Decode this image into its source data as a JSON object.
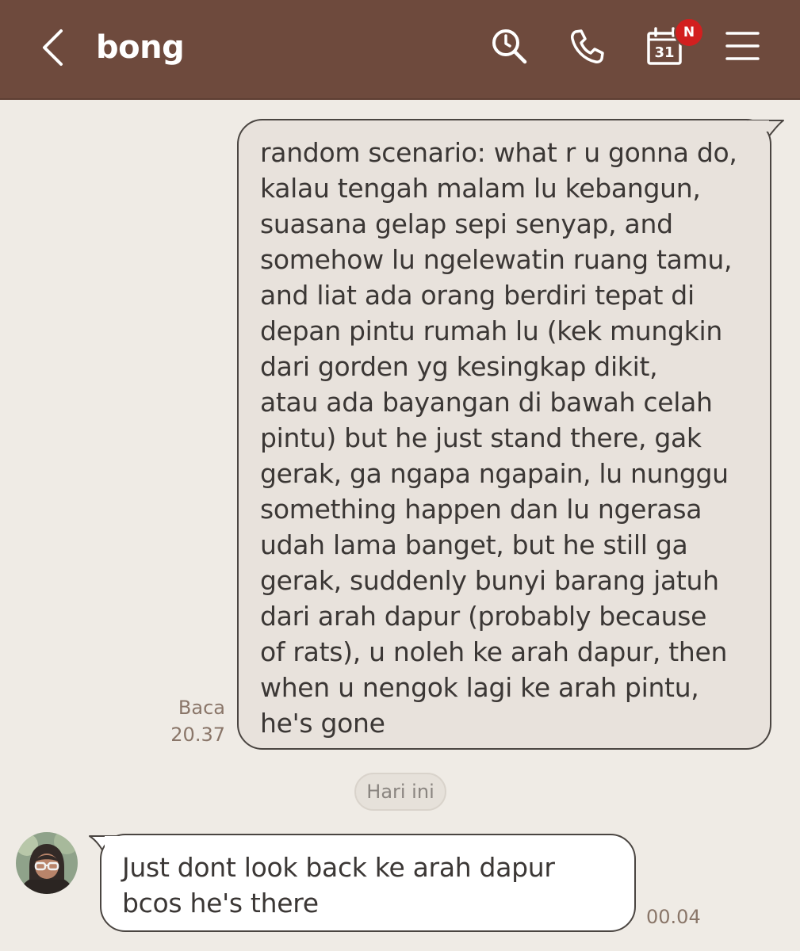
{
  "header": {
    "title": "bong",
    "back_icon": "chevron-left-icon",
    "search_icon": "search-icon",
    "call_icon": "phone-icon",
    "calendar_icon": "calendar-icon",
    "calendar_day": "31",
    "calendar_badge": "N",
    "menu_icon": "hamburger-menu-icon",
    "background_color": "#6e4a3d",
    "badge_color": "#d21f1f"
  },
  "messages": [
    {
      "direction": "outgoing",
      "text": "random scenario: what r u gonna do,\nkalau tengah malam lu kebangun,\nsuasana gelap sepi senyap, and\nsomehow lu ngelewatin ruang tamu,\nand liat ada orang berdiri tepat di\ndepan pintu rumah lu (kek mungkin\ndari gorden yg kesingkap dikit,\natau ada bayangan di bawah celah\npintu) but he just stand there, gak\ngerak, ga ngapa ngapain, lu nunggu\nsomething happen dan lu ngerasa\nudah lama banget, but he still ga\ngerak, suddenly bunyi barang jatuh\ndari arah dapur (probably because\nof rats), u noleh ke arah dapur, then\nwhen u nengok lagi ke arah pintu,\nhe's gone",
      "read_status": "Baca",
      "time": "20.37"
    },
    {
      "direction": "incoming",
      "text": "Just dont look back ke arah dapur\nbcos he's there",
      "time": "00.04"
    }
  ],
  "date_separator": "Hari ini",
  "colors": {
    "chat_background": "#efebe5",
    "outgoing_bubble": "#e8e2dc",
    "incoming_bubble": "#ffffff",
    "meta_text": "#8a7669"
  }
}
